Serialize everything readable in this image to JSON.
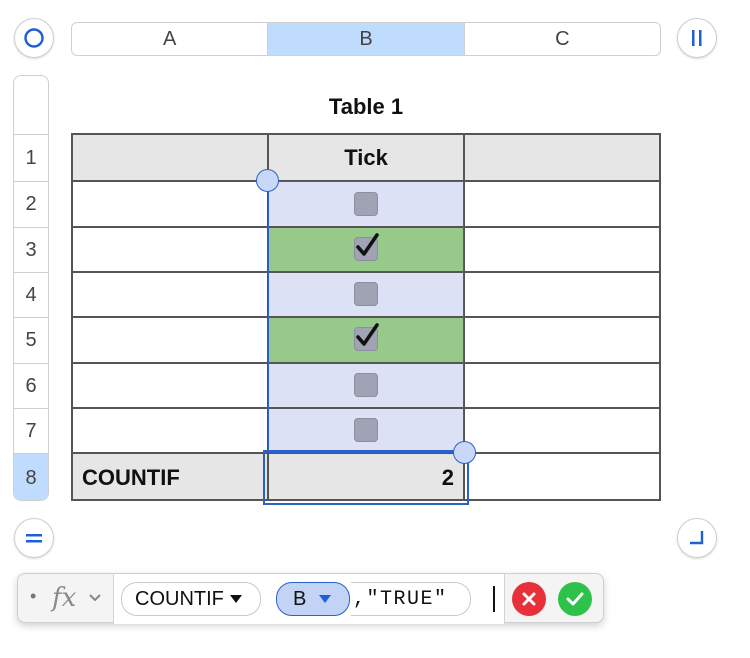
{
  "column_headers": [
    "A",
    "B",
    "C"
  ],
  "selected_column": "B",
  "row_headers": [
    "1",
    "2",
    "3",
    "4",
    "5",
    "6",
    "7",
    "8"
  ],
  "selected_row": "8",
  "table": {
    "title": "Table 1",
    "header_row": [
      "",
      "Tick",
      ""
    ],
    "checkboxes": [
      false,
      true,
      false,
      true,
      false,
      false
    ],
    "footer": {
      "label": "COUNTIF",
      "value": "2"
    }
  },
  "formula_bar": {
    "bullet": "•",
    "fx_label": "fx",
    "function_name": "COUNTIF",
    "arg_reference": "B",
    "arg_rest": ",\"TRUE\""
  },
  "colors": {
    "selection_blue": "#2a62c9",
    "selection_fill": "#dde1f6",
    "checked_fill": "#97c98b",
    "header_fill": "#e6e6e6",
    "cancel_red": "#e8303a",
    "accept_green": "#2ec24a"
  },
  "icons": {
    "top_left": "circle-select-icon",
    "top_right": "pause-column-icon",
    "bottom_left": "equals-row-icon",
    "bottom_right": "resize-corner-icon",
    "cancel": "cancel-x-icon",
    "accept": "accept-check-icon"
  }
}
